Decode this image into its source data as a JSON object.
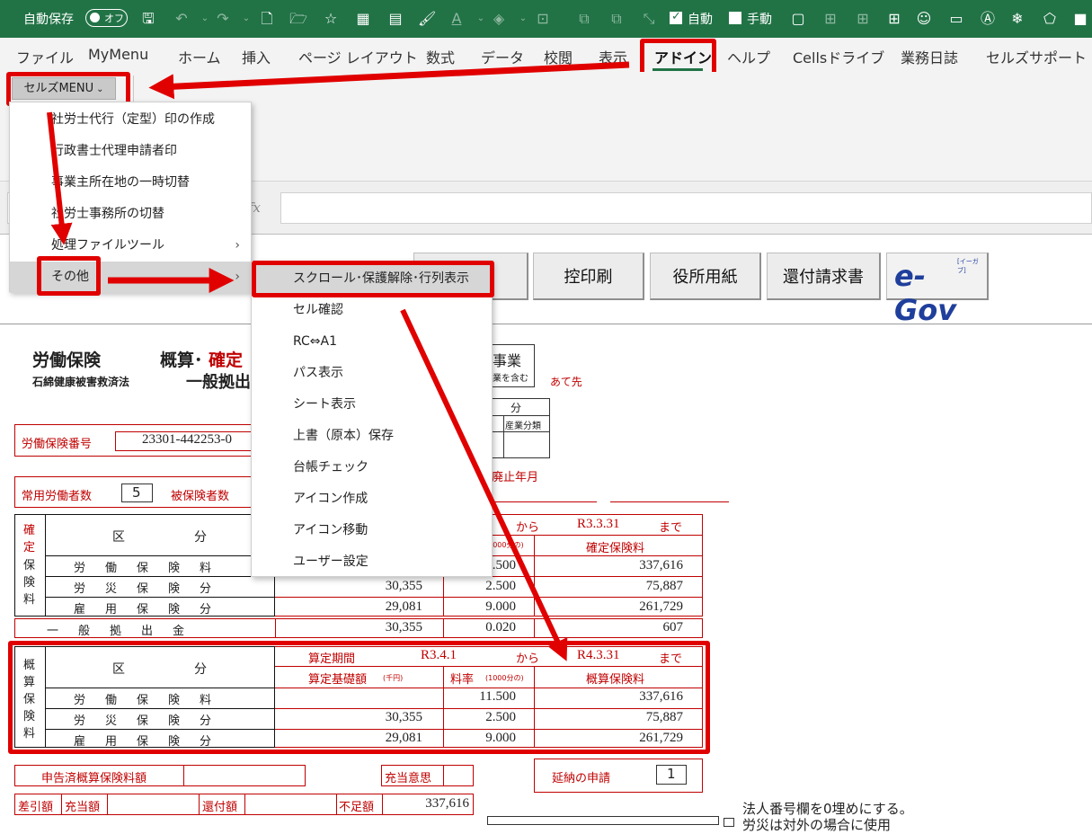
{
  "titlebar": {
    "autosave_label": "自動保存",
    "autosave_state": "オフ",
    "auto_label": "自動",
    "manual_label": "手動"
  },
  "tabs": [
    "ファイル",
    "MyMenu",
    "ホーム",
    "挿入",
    "ページ レイアウト",
    "数式",
    "データ",
    "校閲",
    "表示",
    "アドイン",
    "ヘルプ",
    "Cellsドライブ",
    "業務日誌",
    "セルズサポート"
  ],
  "ribbon": {
    "menu_button": "セルズMENU"
  },
  "menu1": {
    "items": [
      "社労士代行（定型）印の作成",
      "行政書士代理申請者印",
      "事業主所在地の一時切替",
      "社労士事務所の切替",
      "処理ファイルツール",
      "その他"
    ]
  },
  "menu2": {
    "items": [
      "スクロール･保護解除･行列表示",
      "セル確認",
      "RC⇔A1",
      "パス表示",
      "シート表示",
      "上書（原本）保存",
      "台帳チェック",
      "アイコン作成",
      "アイコン移動",
      "ユーザー設定"
    ]
  },
  "sheet_buttons": [
    "控印刷",
    "役所用紙",
    "還付請求書"
  ],
  "egov": {
    "logo": "e-Gov",
    "sub": "[イーガブ]"
  },
  "form": {
    "title1": "労働保険",
    "title2a": "概算･",
    "title2b": "確定",
    "subtitle1": "石綿健康被害救済法",
    "subtitle2": "一般拠出",
    "industry_fragment": "事業",
    "industry_note": "業を含む",
    "recipient": "あて先",
    "bun": "分",
    "industry_class": "産業分類",
    "labor_no_label": "労働保険番号",
    "labor_no_value": "23301-442253-0",
    "workers_label": "常用労働者数",
    "workers_value": "5",
    "insured_label": "被保険者数",
    "abolish_label": "廃止年月",
    "confirmed": {
      "side": [
        "確",
        "定",
        "保",
        "険",
        "料"
      ],
      "kubun": "区",
      "bun": "分",
      "period_from_label": "から",
      "period_to": "R3.3.31",
      "period_to_label": "まで",
      "rate_unit": "(1000分の)",
      "premium_header": "確定保険料",
      "rows": [
        {
          "label": "労働保険料",
          "base": "",
          "rate": "11.500",
          "premium": "337,616"
        },
        {
          "label": "労災保険分",
          "base": "30,355",
          "rate": "2.500",
          "premium": "75,887"
        },
        {
          "label": "雇用保険分",
          "base": "29,081",
          "rate": "9.000",
          "premium": "261,729"
        }
      ],
      "general": {
        "label": "一般拠出金",
        "base": "30,355",
        "rate": "0.020",
        "premium": "607"
      }
    },
    "estimated": {
      "side": [
        "概",
        "算",
        "保",
        "険",
        "料"
      ],
      "kubun": "区",
      "bun": "分",
      "period_label": "算定期間",
      "period_from": "R3.4.1",
      "period_from_label": "から",
      "period_to": "R4.3.31",
      "period_to_label": "まで",
      "base_header": "算定基礎額",
      "base_unit": "(千円)",
      "rate_header": "料率",
      "rate_unit": "(1000分の)",
      "premium_header": "概算保険料",
      "rows": [
        {
          "label": "労働保険料",
          "base": "",
          "rate": "11.500",
          "premium": "337,616"
        },
        {
          "label": "労災保険分",
          "base": "30,355",
          "rate": "2.500",
          "premium": "75,887"
        },
        {
          "label": "雇用保険分",
          "base": "29,081",
          "rate": "9.000",
          "premium": "261,729"
        }
      ]
    },
    "declared_label": "申告済概算保険料額",
    "allocate_label": "充当意思",
    "deferral_label": "延納の申請",
    "deferral_value": "1",
    "diff_label": "差引額",
    "allocation_label": "充当額",
    "refund_label": "還付額",
    "shortage_label": "不足額",
    "shortage_value": "337,616",
    "note1": "法人番号欄を0埋めにする。",
    "note2": "労災は対外の場合に使用"
  }
}
